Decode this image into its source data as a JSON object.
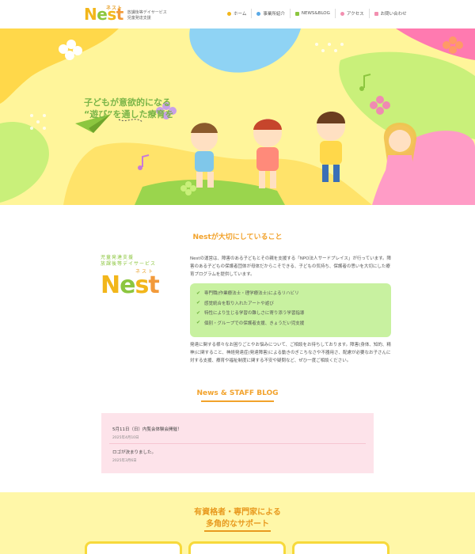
{
  "header": {
    "logo_word": "Nest",
    "logo_ruby": "ネスト",
    "logo_sub1": "放課後等デイサービス",
    "logo_sub2": "児童発達支援",
    "nav": [
      {
        "label": "ホーム",
        "icon": "home-icon",
        "color": "#f2b61b"
      },
      {
        "label": "事業所紹介",
        "icon": "building-icon",
        "color": "#5aa9e6"
      },
      {
        "label": "NEWS&BLOG",
        "icon": "check-icon",
        "color": "#8cc63f"
      },
      {
        "label": "アクセス",
        "icon": "map-pin-icon",
        "color": "#f28fb0"
      },
      {
        "label": "お問い合わせ",
        "icon": "mail-icon",
        "color": "#f28fb0"
      }
    ]
  },
  "hero": {
    "line1": "子どもが意欲的になる",
    "line2": "“遊び”を通した療育を"
  },
  "values": {
    "title": "Nestが大切にしていること",
    "logo_line1": "児童発達支援",
    "logo_line2": "放課後等デイサービス",
    "logo_ruby": "ネスト",
    "logo_word": "Nest",
    "intro": "Nestの運営は、障害のある子どもとその親を支援する「NPO法人サードプレイス」が行っています。障害のある子どもの保護者団体が母体だからこそできる、子どもの気持ち、保護者の思いを大切にした療育プログラムを提供しています。",
    "points": [
      "専門職(作業療法士・理学療法士)によるリハビリ",
      "感覚統合を取り入れたアートや遊び",
      "特性により生じる学習の難しさに寄り添う学習指導",
      "個別・グループでの保護者支援、きょうだい児支援"
    ],
    "closing": "発達に関する様々なお困りごとやお悩みについて、ご相談をお待ちしております。障害(身体、知的、精神)に関すること、神経発達症(発達障害)による動きのぎこちなさや不器用さ、配慮が必要なお子さんに対する支援、療育や福祉制度に関する不安や疑問など、ぜひ一度ご相談ください。"
  },
  "blog": {
    "title": "News & STAFF BLOG",
    "entries": [
      {
        "title": "5月11日（日）内覧会体験会開催！",
        "date": "2025年4月10日"
      },
      {
        "title": "ロゴが決まりました。",
        "date": "2025年3月6日"
      }
    ]
  },
  "support": {
    "line1": "有資格者・専門家による",
    "line2": "多角的なサポート"
  }
}
